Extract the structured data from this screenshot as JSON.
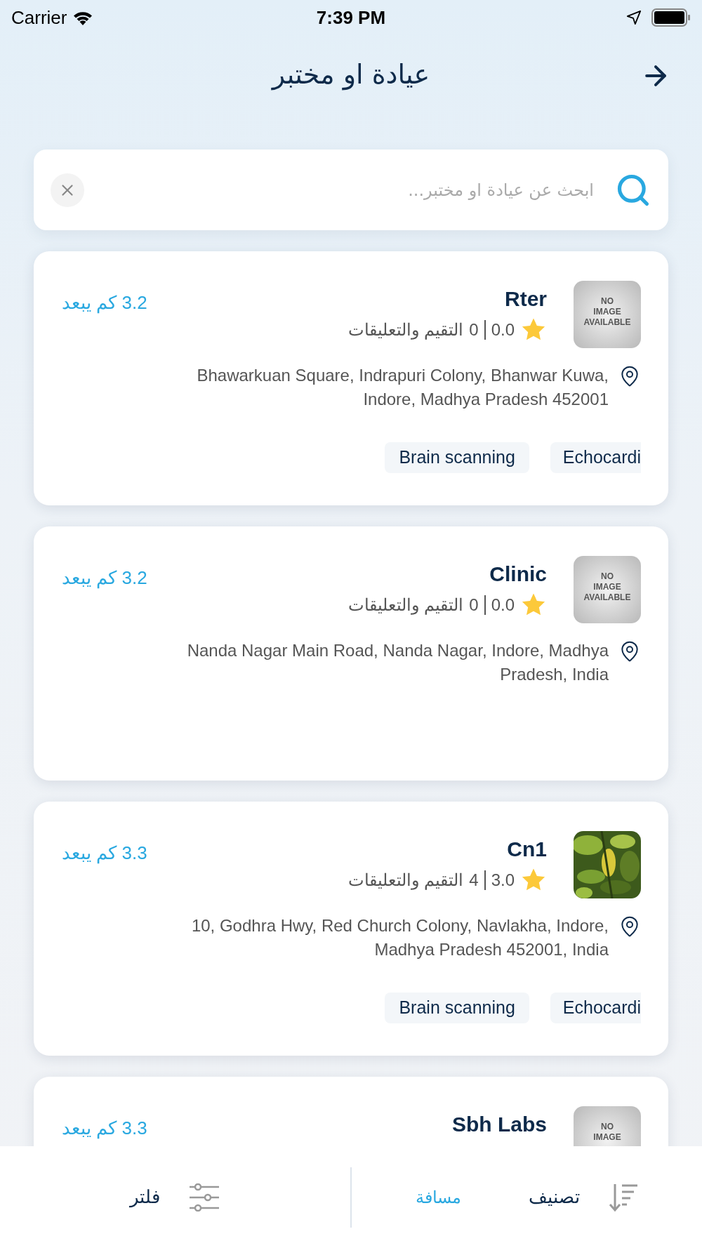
{
  "status_bar": {
    "carrier": "Carrier",
    "time": "7:39 PM"
  },
  "header": {
    "title": "عيادة او مختبر"
  },
  "search": {
    "placeholder": "ابحث عن عيادة او مختبر..."
  },
  "results": [
    {
      "name": "Rter",
      "distance": "3.2 كم يبعد",
      "rating": "0.0",
      "reviews_count": "0",
      "reviews_label": "التقيم والتعليقات",
      "address": "Bhawarkuan Square, Indrapuri Colony, Bhanwar Kuwa, Indore, Madhya Pradesh 452001",
      "image": {
        "kind": "placeholder",
        "lines": [
          "NO",
          "IMAGE",
          "AVAILABLE"
        ]
      },
      "tags": [
        "Echocardi",
        "Brain scanning"
      ]
    },
    {
      "name": "Clinic",
      "distance": "3.2 كم يبعد",
      "rating": "0.0",
      "reviews_count": "0",
      "reviews_label": "التقيم والتعليقات",
      "address": "Nanda Nagar Main Road, Nanda Nagar, Indore, Madhya Pradesh, India",
      "image": {
        "kind": "placeholder",
        "lines": [
          "NO",
          "IMAGE",
          "AVAILABLE"
        ]
      }
    },
    {
      "name": "Cn1",
      "distance": "3.3 كم يبعد",
      "rating": "3.0",
      "reviews_count": "4",
      "reviews_label": "التقيم والتعليقات",
      "address": "10, Godhra Hwy, Red Church Colony, Navlakha, Indore, Madhya Pradesh 452001, India",
      "image": {
        "kind": "picture"
      },
      "tags": [
        "Echocardi",
        "Brain scanning"
      ]
    },
    {
      "name": "Sbh Labs",
      "distance": "3.3 كم يبعد",
      "image": {
        "kind": "placeholder",
        "lines": [
          "NO",
          "IMAGE"
        ]
      }
    }
  ],
  "bottom_bar": {
    "sort_label": "تصنيف",
    "sort_value": "مسافة",
    "filter_label": "فلتر"
  }
}
